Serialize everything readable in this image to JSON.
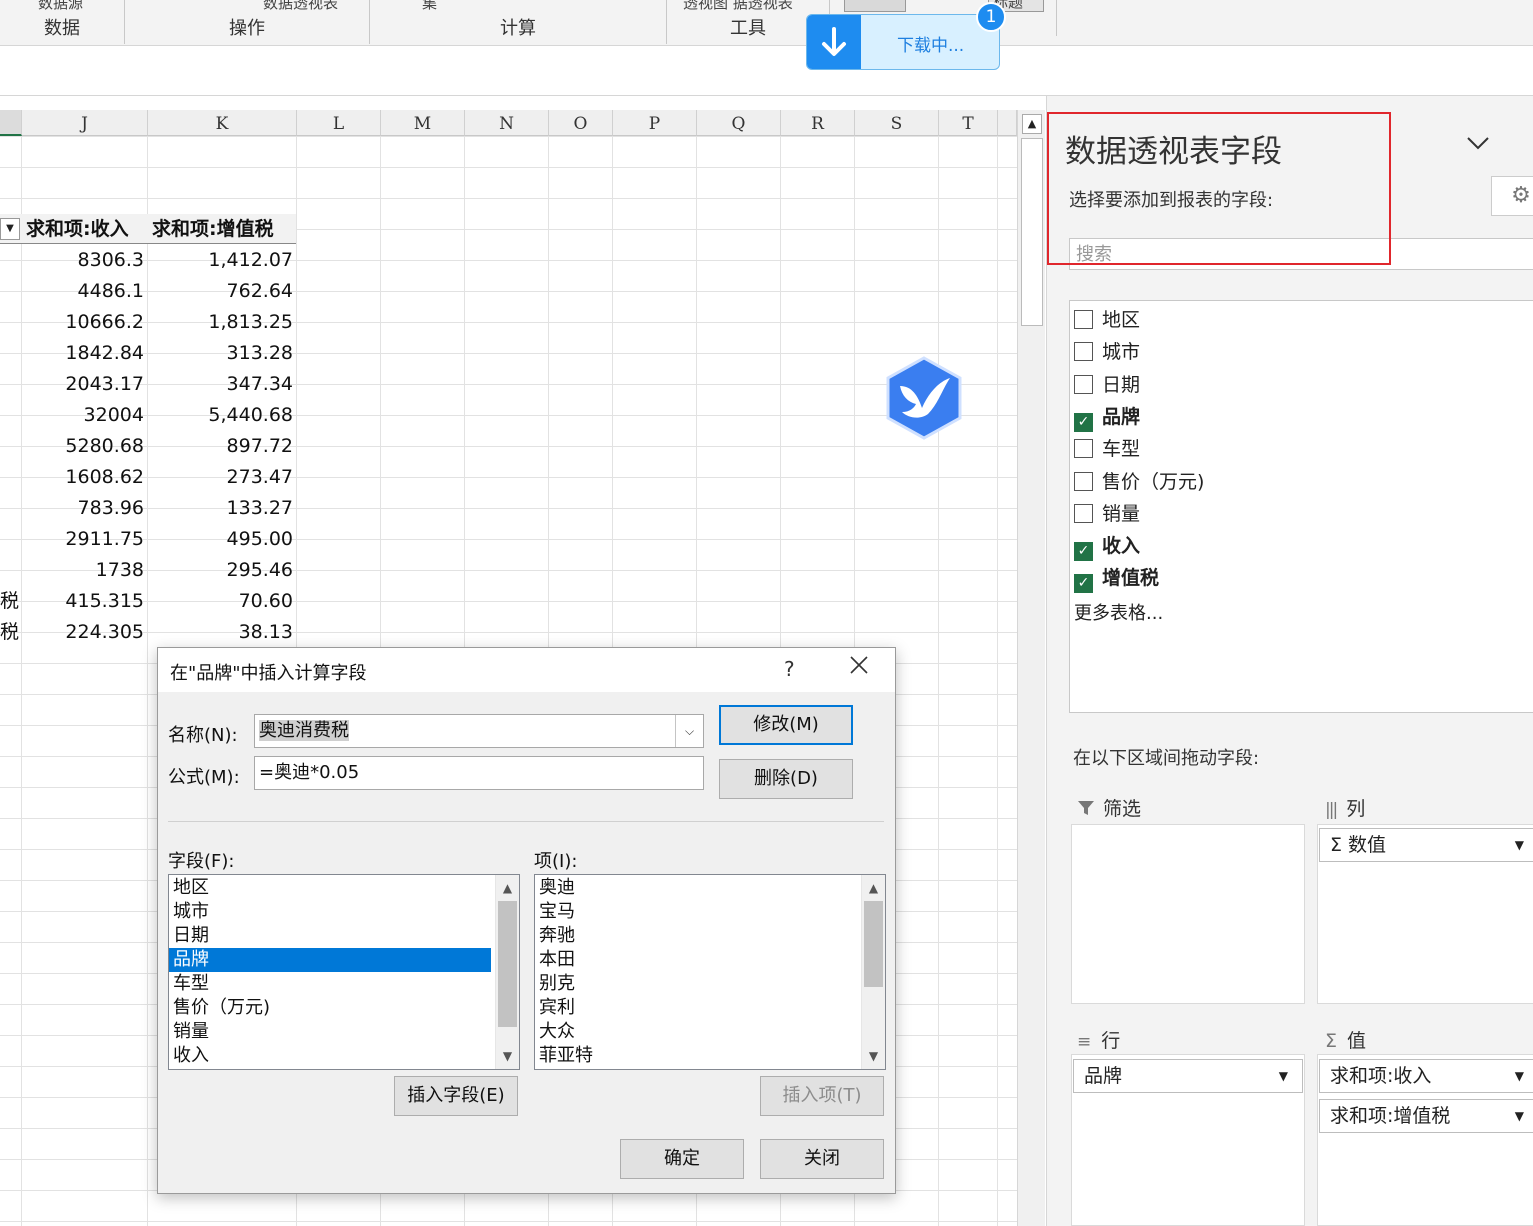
{
  "ribbon": {
    "groups": [
      {
        "label": "数据",
        "clip": "数据源"
      },
      {
        "label": "操作",
        "clip": "数据透视表"
      },
      {
        "label": "计算",
        "clip": "集"
      },
      {
        "label": "工具",
        "clip": "透视图 据透视表"
      }
    ],
    "clip_right": "标题"
  },
  "toast": {
    "text": "下载中...",
    "badge": "1",
    "icon": "download-arrow-icon"
  },
  "sheet": {
    "columns": [
      "J",
      "K",
      "L",
      "M",
      "N",
      "O",
      "P",
      "Q",
      "R",
      "S",
      "T"
    ],
    "header_row": {
      "income": "求和项:收入",
      "vat": "求和项:增值税"
    },
    "rows": [
      {
        "prefix": "",
        "income": "8306.3",
        "vat": "1,412.07"
      },
      {
        "prefix": "",
        "income": "4486.1",
        "vat": "762.64"
      },
      {
        "prefix": "",
        "income": "10666.2",
        "vat": "1,813.25"
      },
      {
        "prefix": "",
        "income": "1842.84",
        "vat": "313.28"
      },
      {
        "prefix": "",
        "income": "2043.17",
        "vat": "347.34"
      },
      {
        "prefix": "",
        "income": "32004",
        "vat": "5,440.68"
      },
      {
        "prefix": "",
        "income": "5280.68",
        "vat": "897.72"
      },
      {
        "prefix": "",
        "income": "1608.62",
        "vat": "273.47"
      },
      {
        "prefix": "",
        "income": "783.96",
        "vat": "133.27"
      },
      {
        "prefix": "",
        "income": "2911.75",
        "vat": "495.00"
      },
      {
        "prefix": "",
        "income": "1738",
        "vat": "295.46"
      },
      {
        "prefix": "税",
        "income": "415.315",
        "vat": "70.60"
      },
      {
        "prefix": "税",
        "income": "224.305",
        "vat": "38.13"
      }
    ]
  },
  "pivot_panel": {
    "title": "数据透视表字段",
    "subtitle": "选择要添加到报表的字段:",
    "search_placeholder": "搜索",
    "fields": [
      {
        "label": "地区",
        "checked": false
      },
      {
        "label": "城市",
        "checked": false
      },
      {
        "label": "日期",
        "checked": false
      },
      {
        "label": "品牌",
        "checked": true
      },
      {
        "label": "车型",
        "checked": false
      },
      {
        "label": "售价（万元)",
        "checked": false
      },
      {
        "label": "销量",
        "checked": false
      },
      {
        "label": "收入",
        "checked": true
      },
      {
        "label": "增值税",
        "checked": true
      }
    ],
    "more_tables": "更多表格...",
    "drag_hint": "在以下区域间拖动字段:",
    "areas": {
      "filter": {
        "label": "筛选",
        "items": []
      },
      "columns": {
        "label": "列",
        "items": [
          "Σ 数值"
        ]
      },
      "rows": {
        "label": "行",
        "items": [
          "品牌"
        ]
      },
      "values": {
        "label": "值",
        "items": [
          "求和项:收入",
          "求和项:增值税"
        ]
      }
    }
  },
  "dialog": {
    "title": "在\"品牌\"中插入计算字段",
    "help": "?",
    "name_label": "名称(N):",
    "name_value": "奥迪消费税",
    "formula_label": "公式(M):",
    "formula_value": "=奥迪*0.05",
    "modify_button": "修改(M)",
    "delete_button": "删除(D)",
    "fields_label": "字段(F):",
    "fields": [
      "地区",
      "城市",
      "日期",
      "品牌",
      "车型",
      "售价（万元)",
      "销量",
      "收入"
    ],
    "selected_field": "品牌",
    "items_label": "项(I):",
    "items": [
      "奥迪",
      "宝马",
      "奔驰",
      "本田",
      "别克",
      "宾利",
      "大众",
      "菲亚特"
    ],
    "insert_field_button": "插入字段(E)",
    "insert_item_button": "插入项(T)",
    "ok_button": "确定",
    "close_button": "关闭"
  }
}
